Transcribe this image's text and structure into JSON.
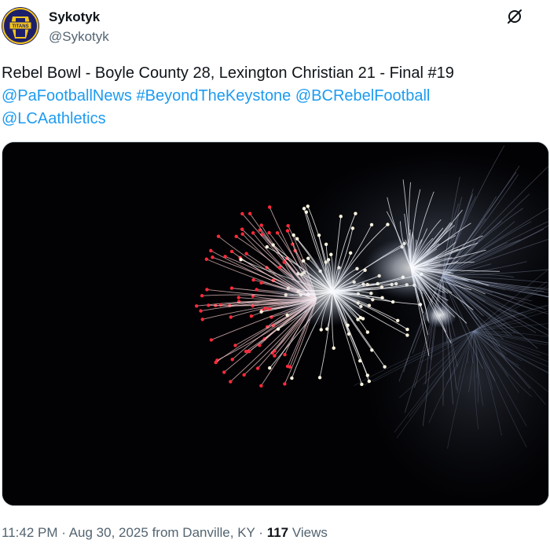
{
  "author": {
    "name": "Sykotyk",
    "handle": "@Sykotyk",
    "avatar_text": "TITANS"
  },
  "tweet": {
    "text_line1": "Rebel Bowl - Boyle County 28, Lexington Christian 21 - Final #19",
    "mentions_line2": [
      "@PaFootballNews",
      "#BeyondTheKeystone",
      "@BCRebelFootball"
    ],
    "mentions_line3": [
      "@LCAathletics"
    ]
  },
  "media": {
    "icon": "fireworks-photo"
  },
  "meta": {
    "time": "11:42 PM",
    "sep1": " · ",
    "date": "Aug 30, 2025",
    "location": " from Danville, KY",
    "sep2": " · ",
    "views_count": "117",
    "views_label": " Views"
  },
  "colors": {
    "link": "#1d9bf0",
    "secondary": "#536471",
    "avatar_gold": "#f5c518",
    "avatar_navy": "#1d1f6b"
  }
}
